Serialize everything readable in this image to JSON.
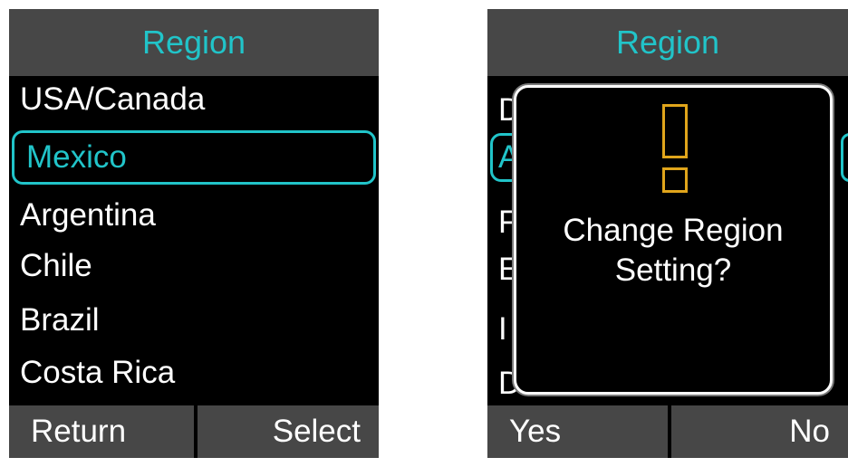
{
  "left_screen": {
    "header": "Region",
    "items": [
      "USA/Canada",
      "Mexico",
      "Argentina",
      "Chile",
      "Brazil",
      "Costa Rica"
    ],
    "selected_index": 1,
    "softkeys": {
      "left": "Return",
      "right": "Select"
    }
  },
  "right_screen": {
    "header": "Region",
    "background_letters": [
      "D",
      "A",
      "F",
      "E",
      "I",
      "D"
    ],
    "dialog": {
      "icon": "exclamation-icon",
      "line1": "Change Region",
      "line2": "Setting?"
    },
    "softkeys": {
      "left": "Yes",
      "right": "No"
    }
  },
  "colors": {
    "accent": "#21c4c9",
    "warning": "#e0a51b",
    "header_bg": "#474747"
  }
}
